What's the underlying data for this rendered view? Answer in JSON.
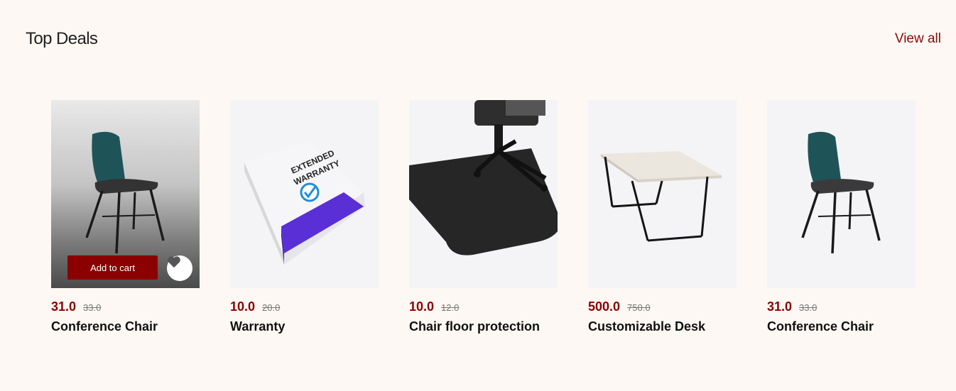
{
  "section": {
    "title": "Top Deals",
    "view_all": "View all"
  },
  "products": [
    {
      "name": "Conference Chair",
      "price": "31.0",
      "old_price": "33.0",
      "image": "chair",
      "add_to_cart": "Add to cart"
    },
    {
      "name": "Warranty",
      "price": "10.0",
      "old_price": "20.0",
      "image": "warranty-box",
      "box_line1": "EXTENDED",
      "box_line2": "WARRANTY"
    },
    {
      "name": "Chair floor protection",
      "price": "10.0",
      "old_price": "12.0",
      "image": "floor-mat"
    },
    {
      "name": "Customizable Desk",
      "price": "500.0",
      "old_price": "750.0",
      "image": "desk"
    },
    {
      "name": "Conference Chair",
      "price": "31.0",
      "old_price": "33.0",
      "image": "chair"
    }
  ],
  "colors": {
    "accent": "#8b0000",
    "background": "#fdf8f3"
  }
}
